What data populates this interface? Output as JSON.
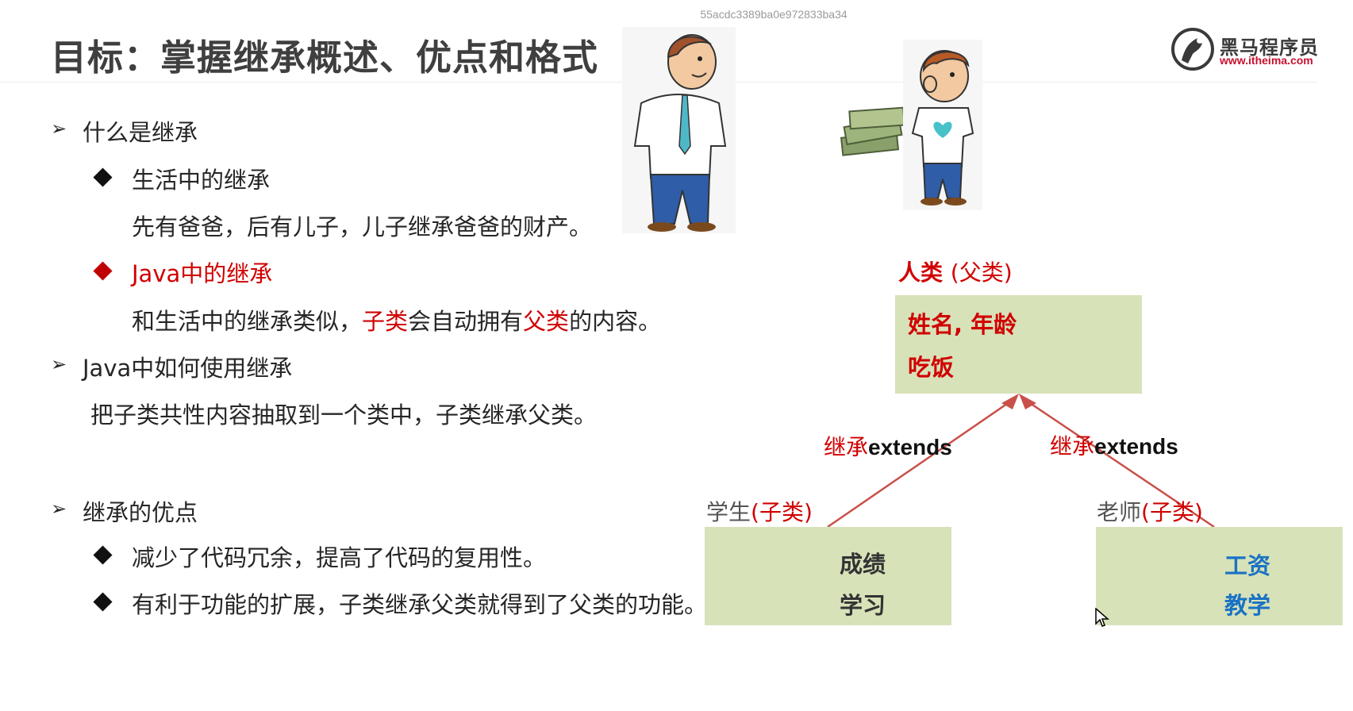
{
  "watermark": "55acdc3389ba0e972833ba34",
  "title": "目标：掌握继承概述、优点和格式",
  "logo": {
    "name": "黑马程序员",
    "url": "www.itheima.com"
  },
  "content": {
    "what_heading": "什么是继承",
    "life_heading": "生活中的继承",
    "life_text": "先有爸爸，后有儿子，儿子继承爸爸的财产。",
    "java_heading": "Java中的继承",
    "java_text_a": "和生活中的继承类似，",
    "java_text_sub": "子类",
    "java_text_b": "会自动拥有",
    "java_text_parent": "父类",
    "java_text_c": "的内容。",
    "how_heading": "Java中如何使用继承",
    "how_text": "把子类共性内容抽取到一个类中，子类继承父类。",
    "adv_heading": "继承的优点",
    "adv_items": [
      "减少了代码冗余，提高了代码的复用性。",
      "有利于功能的扩展，子类继承父类就得到了父类的功能。"
    ]
  },
  "diagram": {
    "parent": {
      "name": "人类",
      "tag": "(父类)",
      "lines": [
        "姓名, 年龄",
        "吃饭"
      ]
    },
    "student": {
      "name": "学生",
      "tag": "(子类)",
      "lines": [
        "成绩",
        "学习"
      ]
    },
    "teacher": {
      "name": "老师",
      "tag": "(子类)",
      "lines": [
        "工资",
        "教学"
      ]
    },
    "extends_cn": "继承",
    "extends_en": "extends"
  },
  "colors": {
    "accent_red": "#d00000",
    "box_green": "#d7e2b9",
    "teacher_blue": "#1a72c4",
    "arrow": "#c9504a"
  }
}
